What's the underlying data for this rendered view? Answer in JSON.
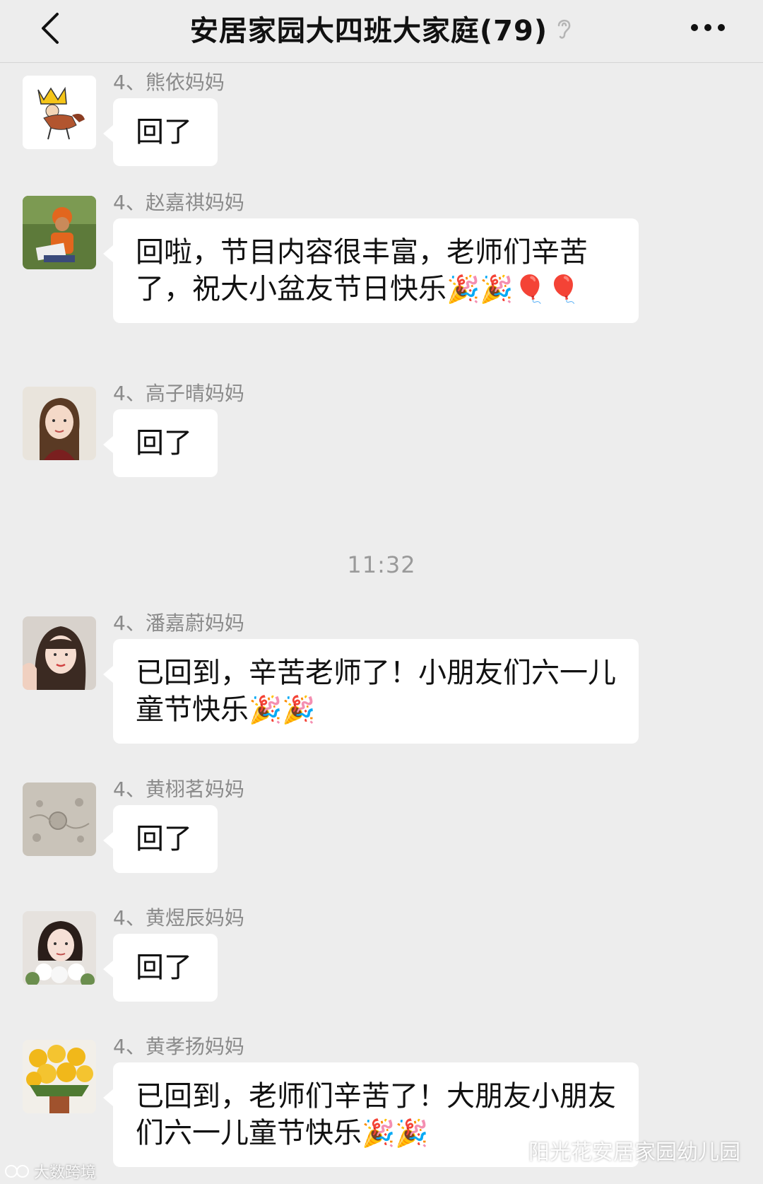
{
  "header": {
    "title": "安居家园大四班大家庭(79)",
    "back_icon": "chevron-left-icon",
    "mute_icon": "ear-icon",
    "more_icon": "more-dots-icon"
  },
  "messages": [
    {
      "sender": "4、熊依妈妈",
      "text": "回了",
      "emoji": ""
    },
    {
      "sender": "4、赵嘉祺妈妈",
      "text": "回啦，节目内容很丰富，老师们辛苦了，祝大小盆友节日快乐",
      "emoji": "🎉🎉🎈🎈"
    },
    {
      "sender": "4、高子晴妈妈",
      "text": "回了",
      "emoji": ""
    },
    {
      "sender": "4、潘嘉蔚妈妈",
      "text": "已回到，辛苦老师了！小朋友们六一儿童节快乐",
      "emoji": "🎉🎉"
    },
    {
      "sender": "4、黄栩茗妈妈",
      "text": "回了",
      "emoji": ""
    },
    {
      "sender": "4、黄煜辰妈妈",
      "text": "回了",
      "emoji": ""
    },
    {
      "sender": "4、黄孝扬妈妈",
      "text": "已回到，老师们辛苦了！大朋友小朋友们六一儿童节快乐",
      "emoji": "🎉🎉"
    }
  ],
  "timestamp": "11:32",
  "watermark_right": "阳光花安居家园幼儿园",
  "watermark_left": "大数跨境",
  "colors": {
    "background": "#ededed",
    "bubble": "#ffffff",
    "sender": "#8a8a8a"
  }
}
